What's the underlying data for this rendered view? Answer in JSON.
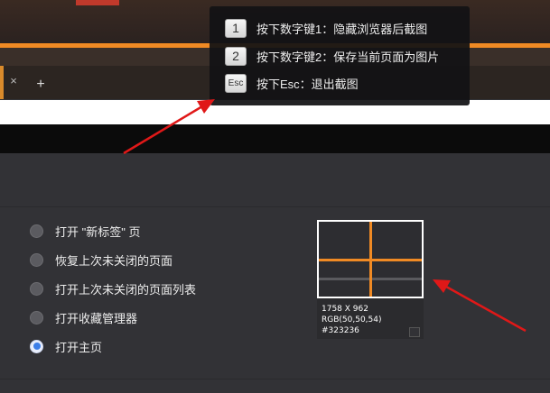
{
  "browser": {
    "tab_close_glyph": "×",
    "new_tab_glyph": "+"
  },
  "tooltip": {
    "items": [
      {
        "key": "1",
        "text": "按下数字键1：隐藏浏览器后截图"
      },
      {
        "key": "2",
        "text": "按下数字键2：保存当前页面为图片"
      },
      {
        "key": "Esc",
        "text": "按下Esc：退出截图"
      }
    ]
  },
  "startup_options": {
    "items": [
      {
        "label": "打开 \"新标签\" 页",
        "selected": false
      },
      {
        "label": "恢复上次未关闭的页面",
        "selected": false
      },
      {
        "label": "打开上次未关闭的页面列表",
        "selected": false
      },
      {
        "label": "打开收藏管理器",
        "selected": false
      },
      {
        "label": "打开主页",
        "selected": true
      }
    ]
  },
  "magnifier": {
    "dimensions": "1758 X 962",
    "rgb": "RGB(50,50,54)",
    "hex": "#323236",
    "crosshair_color": "#f08a24",
    "swatch_color": "#323236"
  },
  "annotations": {
    "arrow_color": "#e01818"
  },
  "colors": {
    "accent_orange": "#f08a24",
    "page_background": "#323236",
    "radio_selected": "#3c7ee8"
  }
}
